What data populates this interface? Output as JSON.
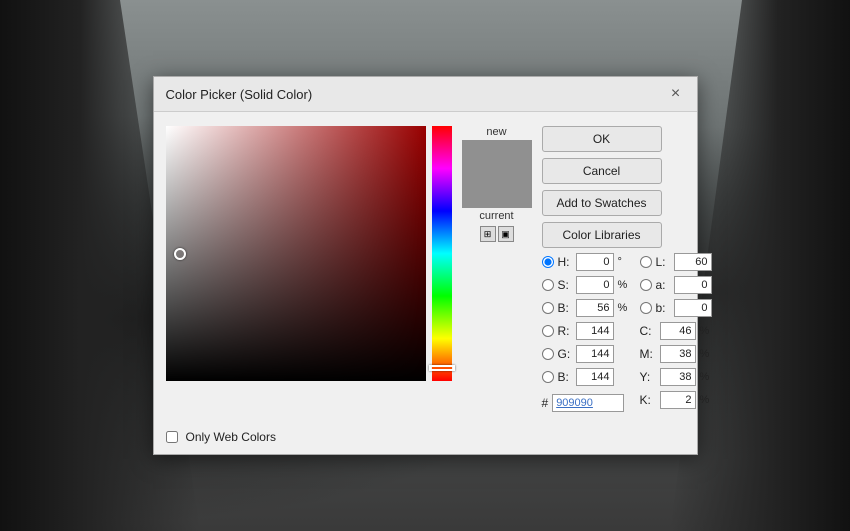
{
  "background": {
    "description": "Dark forest background"
  },
  "dialog": {
    "title": "Color Picker (Solid Color)",
    "close_label": "×",
    "buttons": {
      "ok": "OK",
      "cancel": "Cancel",
      "add_to_swatches": "Add to Swatches",
      "color_libraries": "Color Libraries"
    },
    "color_preview": {
      "new_label": "new",
      "current_label": "current",
      "new_color": "#909090",
      "current_color": "#909090"
    },
    "fields": {
      "h_label": "H:",
      "h_value": "0",
      "h_unit": "°",
      "s_label": "S:",
      "s_value": "0",
      "s_unit": "%",
      "b_label": "B:",
      "b_value": "56",
      "b_unit": "%",
      "r_label": "R:",
      "r_value": "144",
      "g_label": "G:",
      "g_value": "144",
      "b2_label": "B:",
      "b2_value": "144",
      "l_label": "L:",
      "l_value": "60",
      "a_label": "a:",
      "a_value": "0",
      "b3_label": "b:",
      "b3_value": "0",
      "c_label": "C:",
      "c_value": "46",
      "c_unit": "%",
      "m_label": "M:",
      "m_value": "38",
      "m_unit": "%",
      "y_label": "Y:",
      "y_value": "38",
      "y_unit": "%",
      "k_label": "K:",
      "k_value": "2",
      "k_unit": "%",
      "hex_hash": "#",
      "hex_value": "909090"
    },
    "web_colors": {
      "checkbox_checked": false,
      "label": "Only Web Colors"
    }
  }
}
